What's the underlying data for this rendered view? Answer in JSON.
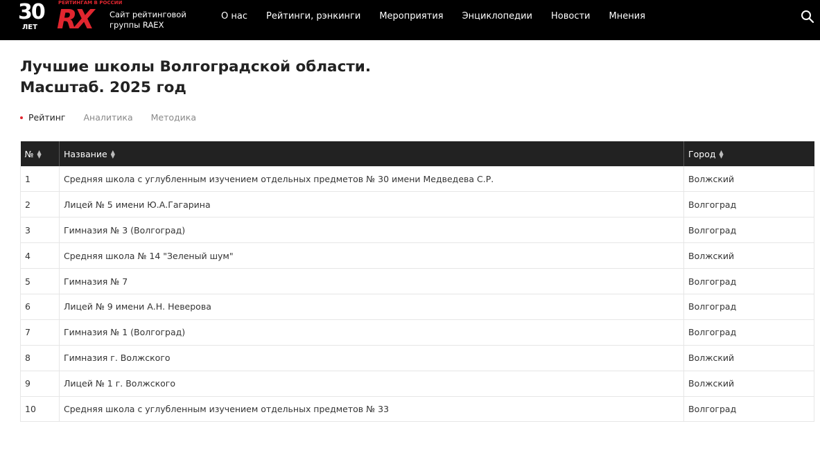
{
  "header": {
    "logo": {
      "num": "30",
      "years": "ЛЕТ",
      "slogan": "РЕЙТИНГАМ В РОССИИ",
      "brand": "RX"
    },
    "site_desc": "Сайт рейтинговой группы RAEX",
    "nav": [
      "О нас",
      "Рейтинги, рэнкинги",
      "Мероприятия",
      "Энциклопедии",
      "Новости",
      "Мнения"
    ],
    "search_icon": "search-icon"
  },
  "page": {
    "title_line1": "Лучшие школы Волгоградской области.",
    "title_line2": "Масштаб. 2025 год"
  },
  "tabs": [
    {
      "label": "Рейтинг",
      "active": true
    },
    {
      "label": "Аналитика",
      "active": false
    },
    {
      "label": "Методика",
      "active": false
    }
  ],
  "colors": {
    "accent": "#e0262f",
    "header_bg": "#000000",
    "table_head_bg": "#222222"
  },
  "table": {
    "columns": [
      "№",
      "Название",
      "Город"
    ],
    "rows": [
      [
        "1",
        "Средняя школа с углубленным изучением отдельных предметов № 30 имени Медведева С.Р.",
        "Волжский"
      ],
      [
        "2",
        "Лицей № 5 имени Ю.А.Гагарина",
        "Волгоград"
      ],
      [
        "3",
        "Гимназия № 3 (Волгоград)",
        "Волгоград"
      ],
      [
        "4",
        "Средняя школа № 14 \"Зеленый шум\"",
        "Волжский"
      ],
      [
        "5",
        "Гимназия № 7",
        "Волгоград"
      ],
      [
        "6",
        "Лицей № 9 имени А.Н. Неверова",
        "Волгоград"
      ],
      [
        "7",
        "Гимназия № 1 (Волгоград)",
        "Волгоград"
      ],
      [
        "8",
        "Гимназия г. Волжского",
        "Волжский"
      ],
      [
        "9",
        "Лицей № 1 г. Волжского",
        "Волжский"
      ],
      [
        "10",
        "Средняя школа с углубленным изучением отдельных предметов № 33",
        "Волгоград"
      ]
    ]
  }
}
